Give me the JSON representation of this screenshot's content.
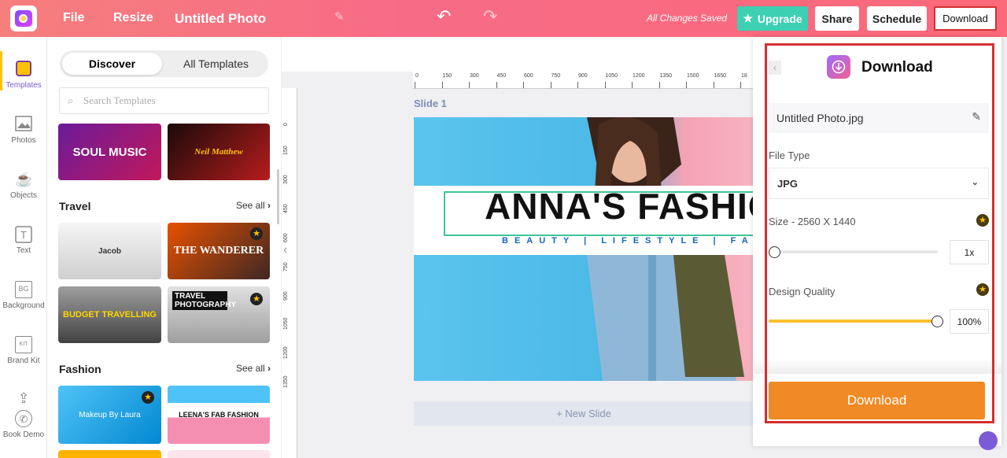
{
  "topbar": {
    "menu_file": "File",
    "menu_resize": "Resize",
    "doc_title": "Untitled Photo",
    "saved_status": "All Changes Saved",
    "upgrade": "Upgrade",
    "share": "Share",
    "schedule": "Schedule",
    "download": "Download"
  },
  "leftnav": {
    "items": [
      {
        "label": "Templates"
      },
      {
        "label": "Photos"
      },
      {
        "label": "Objects"
      },
      {
        "label": "Text"
      },
      {
        "label": "Background",
        "icon_text": "BG"
      },
      {
        "label": "Brand Kit",
        "icon_text": "KIT"
      },
      {
        "label": "Book Demo"
      }
    ]
  },
  "panel": {
    "tab_discover": "Discover",
    "tab_all": "All Templates",
    "search_placeholder": "Search Templates",
    "top_thumbs": [
      {
        "text": "SOUL MUSIC"
      },
      {
        "text": "Neil Matthew"
      }
    ],
    "travel": {
      "title": "Travel",
      "see_all": "See all",
      "thumbs": [
        {
          "text": "Jacob"
        },
        {
          "text": "THE WANDERER"
        },
        {
          "text": "BUDGET TRAVELLING"
        },
        {
          "text": "TRAVEL PHOTOGRAPHY"
        }
      ]
    },
    "fashion": {
      "title": "Fashion",
      "see_all": "See all",
      "thumbs": [
        {
          "text": "Makeup By Laura"
        },
        {
          "text": "LEENA'S FAB FASHION"
        }
      ]
    }
  },
  "canvas": {
    "slide_label": "Slide 1",
    "headline": "ANNA'S FASHIO",
    "tagline": "BEAUTY | LIFESTYLE | FAS",
    "new_slide": "+ New Slide",
    "ruler_top": [
      "0",
      "150",
      "300",
      "450",
      "600",
      "750",
      "900",
      "1050",
      "1200",
      "1350",
      "1500",
      "1650",
      "18"
    ],
    "ruler_left": [
      "0",
      "150",
      "300",
      "450",
      "600",
      "750",
      "900",
      "1050",
      "1200",
      "1350"
    ]
  },
  "download_panel": {
    "title": "Download",
    "filename": "Untitled Photo.jpg",
    "file_type_label": "File Type",
    "file_type": "JPG",
    "size_label": "Size - 2560 X 1440",
    "size_value": "1x",
    "size_level": 0.0,
    "quality_label": "Design Quality",
    "quality_value": "100%",
    "quality_level": 1.0,
    "download_button": "Download"
  },
  "colors": {
    "accent": "#f76b86",
    "upgrade": "#3dd0b2",
    "download": "#f08a24",
    "highlight": "#d32f2f",
    "slide_bg": "#5cc6f0"
  }
}
